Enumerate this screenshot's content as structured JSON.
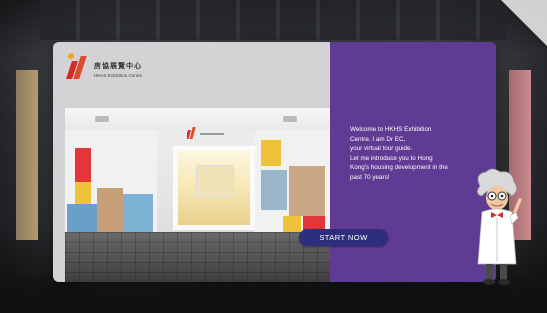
{
  "header": {
    "logo_zh": "房協展覽中心",
    "logo_en": "HKHS Exhibition Centre"
  },
  "photo": {
    "door_sign": "房協展覽中心"
  },
  "welcome": {
    "lines": [
      "Welcome to HKHS Exhibition",
      "Centre. I am Dr EC,",
      "your virtual tour guide.",
      "Let me introduce you to Hong",
      "Kong's housing development in the",
      "past 70 years!"
    ]
  },
  "actions": {
    "start_label": "START NOW"
  },
  "colors": {
    "panel_purple": "#5f3b94",
    "button_navy": "#2d2e7c",
    "logo_red": "#d62b2b",
    "logo_gold": "#f2a81d"
  },
  "icons": {
    "guide": "scientist-guide-character",
    "logo": "hkhs-logo-icon"
  }
}
